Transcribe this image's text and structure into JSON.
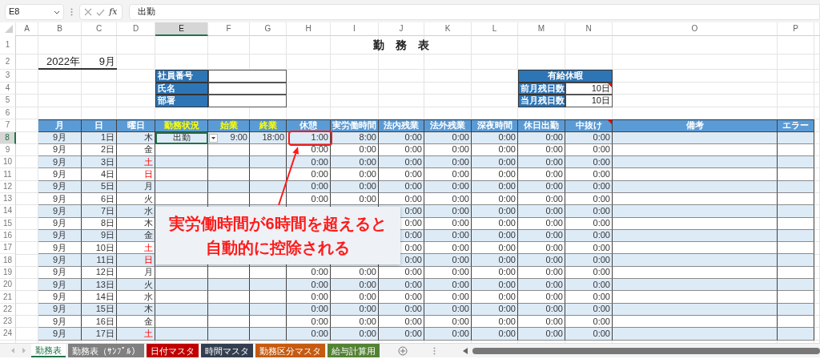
{
  "formula_bar": {
    "name_box": "E8",
    "function_label": "fx",
    "formula": "出勤"
  },
  "column_headers": [
    {
      "label": "A",
      "selected": false
    },
    {
      "label": "B",
      "selected": false
    },
    {
      "label": "C",
      "selected": false
    },
    {
      "label": "D",
      "selected": false
    },
    {
      "label": "E",
      "selected": true
    },
    {
      "label": "F",
      "selected": false
    },
    {
      "label": "G",
      "selected": false
    },
    {
      "label": "H",
      "selected": false
    },
    {
      "label": "I",
      "selected": false
    },
    {
      "label": "J",
      "selected": false
    },
    {
      "label": "K",
      "selected": false
    },
    {
      "label": "L",
      "selected": false
    },
    {
      "label": "M",
      "selected": false
    },
    {
      "label": "N",
      "selected": false
    },
    {
      "label": "O",
      "selected": false
    },
    {
      "label": "P",
      "selected": false
    }
  ],
  "row_numbers": [
    {
      "label": "1",
      "selected": false
    },
    {
      "label": "2",
      "selected": false
    },
    {
      "label": "3",
      "selected": false
    },
    {
      "label": "4",
      "selected": false
    },
    {
      "label": "5",
      "selected": false
    },
    {
      "label": "6",
      "selected": false
    },
    {
      "label": "7",
      "selected": false
    },
    {
      "label": "8",
      "selected": true
    },
    {
      "label": "9",
      "selected": false
    },
    {
      "label": "10",
      "selected": false
    },
    {
      "label": "11",
      "selected": false
    },
    {
      "label": "12",
      "selected": false
    },
    {
      "label": "13",
      "selected": false
    },
    {
      "label": "14",
      "selected": false
    },
    {
      "label": "15",
      "selected": false
    },
    {
      "label": "16",
      "selected": false
    },
    {
      "label": "17",
      "selected": false
    },
    {
      "label": "18",
      "selected": false
    },
    {
      "label": "19",
      "selected": false
    },
    {
      "label": "20",
      "selected": false
    },
    {
      "label": "21",
      "selected": false
    },
    {
      "label": "22",
      "selected": false
    },
    {
      "label": "23",
      "selected": false
    },
    {
      "label": "24",
      "selected": false
    }
  ],
  "title": "勤 務 表",
  "year": "2022年",
  "month": "9月",
  "employee_fields": [
    {
      "label": "社員番号"
    },
    {
      "label": "氏名"
    },
    {
      "label": "部署"
    }
  ],
  "paid_leave": {
    "title": "有給休暇",
    "rows": [
      {
        "label": "前月残日数",
        "value": "10日",
        "has_comment": true
      },
      {
        "label": "当月残日数",
        "value": "10日",
        "has_comment": false
      }
    ]
  },
  "table": {
    "columns": [
      {
        "label": "月",
        "highlight": false,
        "has_comment": false
      },
      {
        "label": "日",
        "highlight": false,
        "has_comment": false
      },
      {
        "label": "曜日",
        "highlight": false,
        "has_comment": false
      },
      {
        "label": "勤務状況",
        "highlight": true,
        "has_comment": false
      },
      {
        "label": "始業",
        "highlight": true,
        "has_comment": false
      },
      {
        "label": "終業",
        "highlight": true,
        "has_comment": false
      },
      {
        "label": "休憩",
        "highlight": false,
        "has_comment": false
      },
      {
        "label": "実労働時間",
        "highlight": false,
        "has_comment": false
      },
      {
        "label": "法内残業",
        "highlight": false,
        "has_comment": false
      },
      {
        "label": "法外残業",
        "highlight": false,
        "has_comment": false
      },
      {
        "label": "深夜時間",
        "highlight": false,
        "has_comment": false
      },
      {
        "label": "休日出勤",
        "highlight": false,
        "has_comment": false
      },
      {
        "label": "中抜け",
        "highlight": false,
        "has_comment": true
      },
      {
        "label": "備考",
        "highlight": false,
        "has_comment": false
      },
      {
        "label": "エラー",
        "highlight": false,
        "has_comment": false
      }
    ],
    "rows": [
      {
        "selected": true,
        "weekend": false,
        "cells": [
          "9月",
          "1日",
          "木",
          "出勤",
          "9:00",
          "18:00",
          "1:00",
          "8:00",
          "0:00",
          "0:00",
          "0:00",
          "0:00",
          "0:00",
          null,
          null
        ]
      },
      {
        "selected": false,
        "weekend": false,
        "cells": [
          "9月",
          "2日",
          "金",
          null,
          null,
          null,
          "0:00",
          "0:00",
          "0:00",
          "0:00",
          "0:00",
          "0:00",
          "0:00",
          null,
          null
        ]
      },
      {
        "selected": false,
        "weekend": true,
        "cells": [
          "9月",
          "3日",
          "土",
          null,
          null,
          null,
          "0:00",
          "0:00",
          "0:00",
          "0:00",
          "0:00",
          "0:00",
          "0:00",
          null,
          null
        ]
      },
      {
        "selected": false,
        "weekend": true,
        "cells": [
          "9月",
          "4日",
          "日",
          null,
          null,
          null,
          "0:00",
          "0:00",
          "0:00",
          "0:00",
          "0:00",
          "0:00",
          "0:00",
          null,
          null
        ]
      },
      {
        "selected": false,
        "weekend": false,
        "cells": [
          "9月",
          "5日",
          "月",
          null,
          null,
          null,
          "0:00",
          "0:00",
          "0:00",
          "0:00",
          "0:00",
          "0:00",
          "0:00",
          null,
          null
        ]
      },
      {
        "selected": false,
        "weekend": false,
        "cells": [
          "9月",
          "6日",
          "火",
          null,
          null,
          null,
          "0:00",
          "0:00",
          "0:00",
          "0:00",
          "0:00",
          "0:00",
          "0:00",
          null,
          null
        ]
      },
      {
        "selected": false,
        "weekend": false,
        "cells": [
          "9月",
          "7日",
          "水",
          null,
          null,
          null,
          null,
          null,
          "0:00",
          "0:00",
          "0:00",
          "0:00",
          "0:00",
          null,
          null
        ]
      },
      {
        "weekend": false,
        "cells": [
          "9月",
          "8日",
          "木",
          null,
          null,
          null,
          null,
          null,
          "0:00",
          "0:00",
          "0:00",
          "0:00",
          "0:00",
          null,
          null
        ]
      },
      {
        "weekend": false,
        "cells": [
          "9月",
          "9日",
          "金",
          null,
          null,
          null,
          null,
          null,
          "0:00",
          "0:00",
          "0:00",
          "0:00",
          "0:00",
          null,
          null
        ]
      },
      {
        "weekend": true,
        "cells": [
          "9月",
          "10日",
          "土",
          null,
          null,
          null,
          null,
          null,
          "0:00",
          "0:00",
          "0:00",
          "0:00",
          "0:00",
          null,
          null
        ]
      },
      {
        "selected": false,
        "weekend": true,
        "cells": [
          "9月",
          "11日",
          "日",
          null,
          null,
          null,
          null,
          null,
          "0:00",
          "0:00",
          "0:00",
          "0:00",
          "0:00",
          null,
          null
        ]
      },
      {
        "selected": false,
        "weekend": false,
        "cells": [
          "9月",
          "12日",
          "月",
          null,
          null,
          null,
          "0:00",
          "0:00",
          "0:00",
          "0:00",
          "0:00",
          "0:00",
          "0:00",
          null,
          null
        ]
      },
      {
        "selected": false,
        "weekend": false,
        "cells": [
          "9月",
          "13日",
          "火",
          null,
          null,
          null,
          "0:00",
          "0:00",
          "0:00",
          "0:00",
          "0:00",
          "0:00",
          "0:00",
          null,
          null
        ]
      },
      {
        "selected": false,
        "weekend": false,
        "cells": [
          "9月",
          "14日",
          "水",
          null,
          null,
          null,
          "0:00",
          "0:00",
          "0:00",
          "0:00",
          "0:00",
          "0:00",
          "0:00",
          null,
          null
        ]
      },
      {
        "selected": false,
        "weekend": false,
        "cells": [
          "9月",
          "15日",
          "木",
          null,
          null,
          null,
          "0:00",
          "0:00",
          "0:00",
          "0:00",
          "0:00",
          "0:00",
          "0:00",
          null,
          null
        ]
      },
      {
        "selected": false,
        "weekend": false,
        "cells": [
          "9月",
          "16日",
          "金",
          null,
          null,
          null,
          "0:00",
          "0:00",
          "0:00",
          "0:00",
          "0:00",
          "0:00",
          "0:00",
          null,
          null
        ]
      },
      {
        "selected": false,
        "weekend": true,
        "cells": [
          "9月",
          "17日",
          "土",
          null,
          null,
          null,
          "0:00",
          "0:00",
          "0:00",
          "0:00",
          "0:00",
          "0:00",
          "0:00",
          null,
          null
        ]
      }
    ]
  },
  "callout": {
    "lines": [
      "実労働時間が6時間を超えると",
      "自動的に控除される"
    ]
  },
  "sheet_tabs": [
    {
      "label": "勤務表",
      "selected": true
    },
    {
      "label": "勤務表（ｻﾝﾌﾟﾙ）",
      "selected": false,
      "color": "#808080"
    },
    {
      "label": "日付マスタ",
      "selected": false,
      "color": "#c00000"
    },
    {
      "label": "時間マスタ",
      "selected": false,
      "color": "#333f4f"
    },
    {
      "label": "勤務区分マスタ",
      "selected": false,
      "color": "#c55a11"
    },
    {
      "label": "給与計算用",
      "selected": false,
      "color": "#548235"
    }
  ]
}
